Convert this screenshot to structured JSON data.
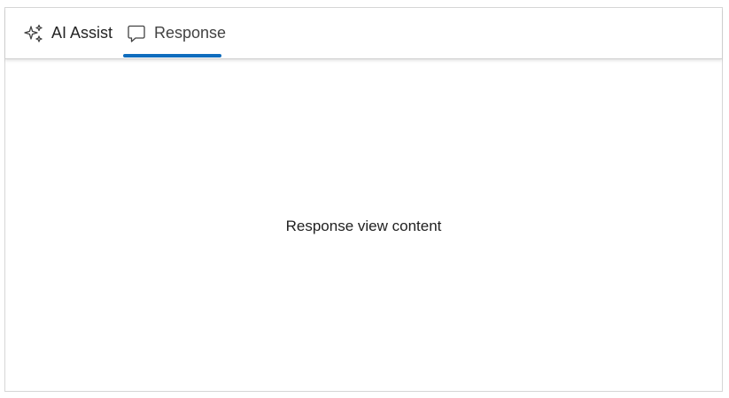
{
  "tabs": [
    {
      "label": "AI Assist",
      "icon": "sparkle-icon",
      "selected": false
    },
    {
      "label": "Response",
      "icon": "chat-bubble-icon",
      "selected": true
    }
  ],
  "content": {
    "text": "Response view content"
  },
  "colors": {
    "accent": "#0f6cbd",
    "border": "#d6d6d6",
    "text": "#242424"
  }
}
